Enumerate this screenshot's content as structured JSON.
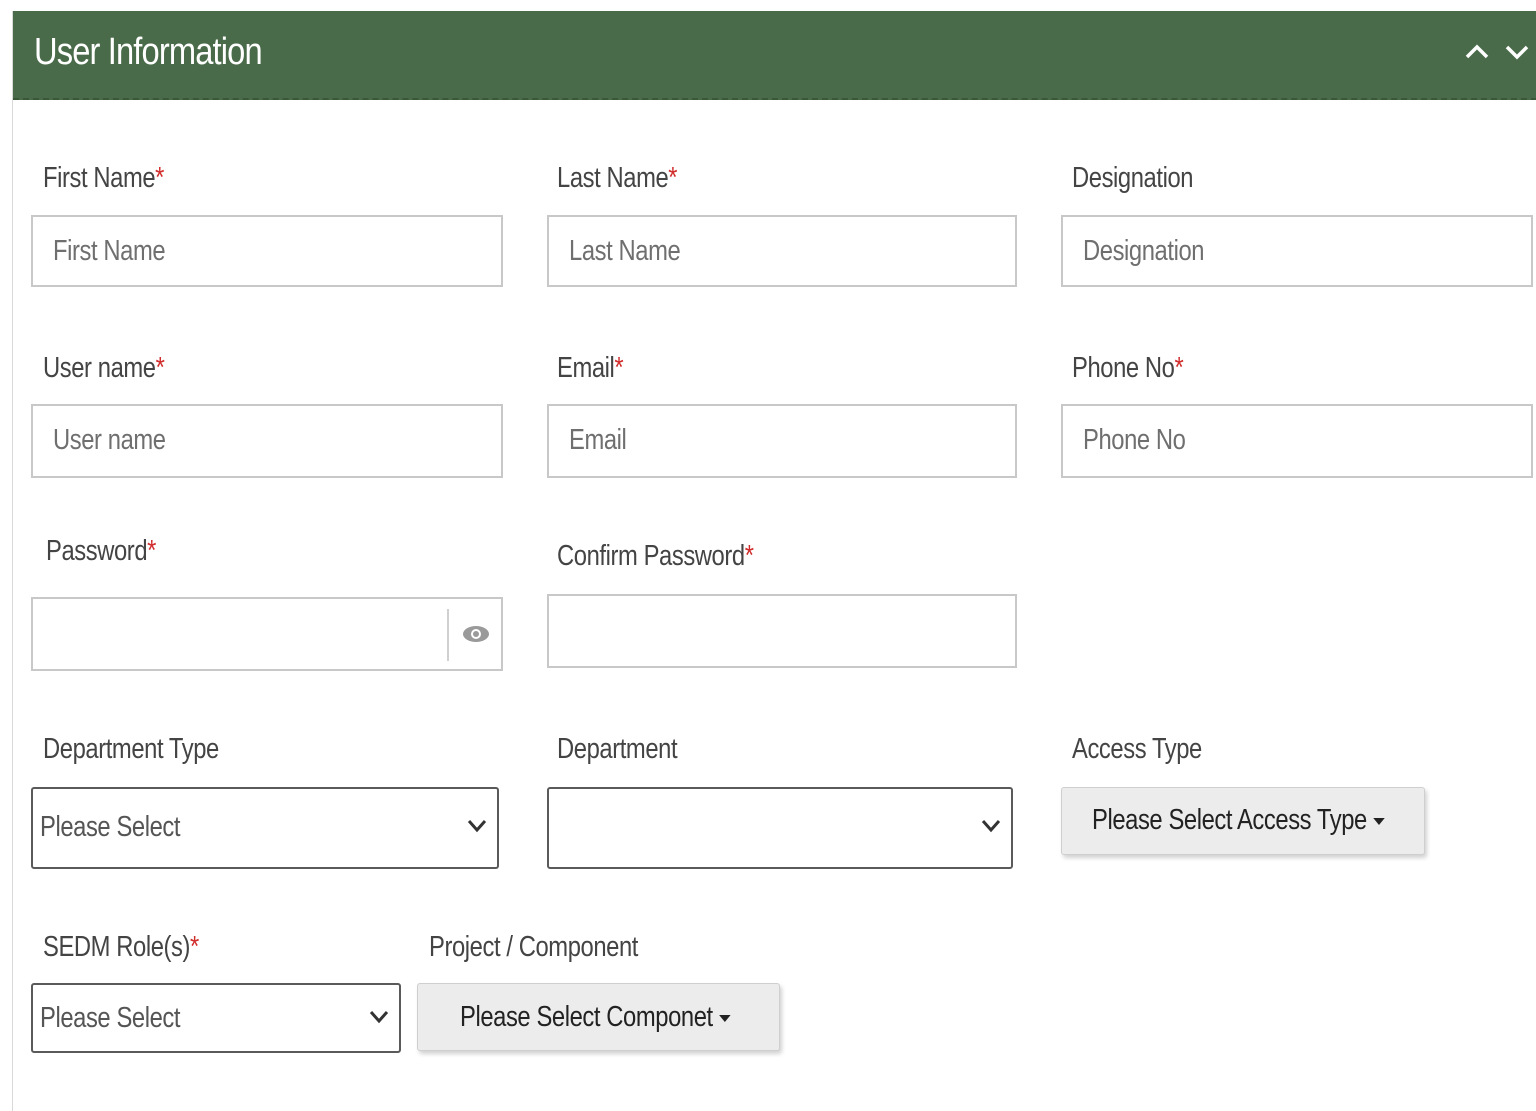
{
  "panel": {
    "title": "User Information",
    "collapse_icon": "chevron-up-icon",
    "expand_icon": "chevron-down-icon",
    "header_color": "#4a6b49"
  },
  "required_marker": "*",
  "required_color": "#d12d2d",
  "fields": {
    "first_name": {
      "label": "First Name",
      "placeholder": "First Name"
    },
    "last_name": {
      "label": "Last Name",
      "placeholder": "Last Name"
    },
    "designation": {
      "label": "Designation",
      "placeholder": "Designation"
    },
    "user_name": {
      "label": "User name",
      "placeholder": "User name"
    },
    "email": {
      "label": "Email",
      "placeholder": "Email"
    },
    "phone_no": {
      "label": "Phone No",
      "placeholder": "Phone No"
    },
    "password": {
      "label": "Password",
      "value": "",
      "toggle_icon": "eye-icon"
    },
    "confirm_password": {
      "label": "Confirm Password",
      "value": ""
    },
    "department_type": {
      "label": "Department Type",
      "selected": "Please Select"
    },
    "department": {
      "label": "Department",
      "selected": ""
    },
    "access_type": {
      "label": "Access Type",
      "button": "Please Select Access Type"
    },
    "sedm_roles": {
      "label": "SEDM Role(s)",
      "selected": "Please Select"
    },
    "project_component": {
      "label": "Project / Component",
      "button": "Please Select Componet"
    }
  }
}
